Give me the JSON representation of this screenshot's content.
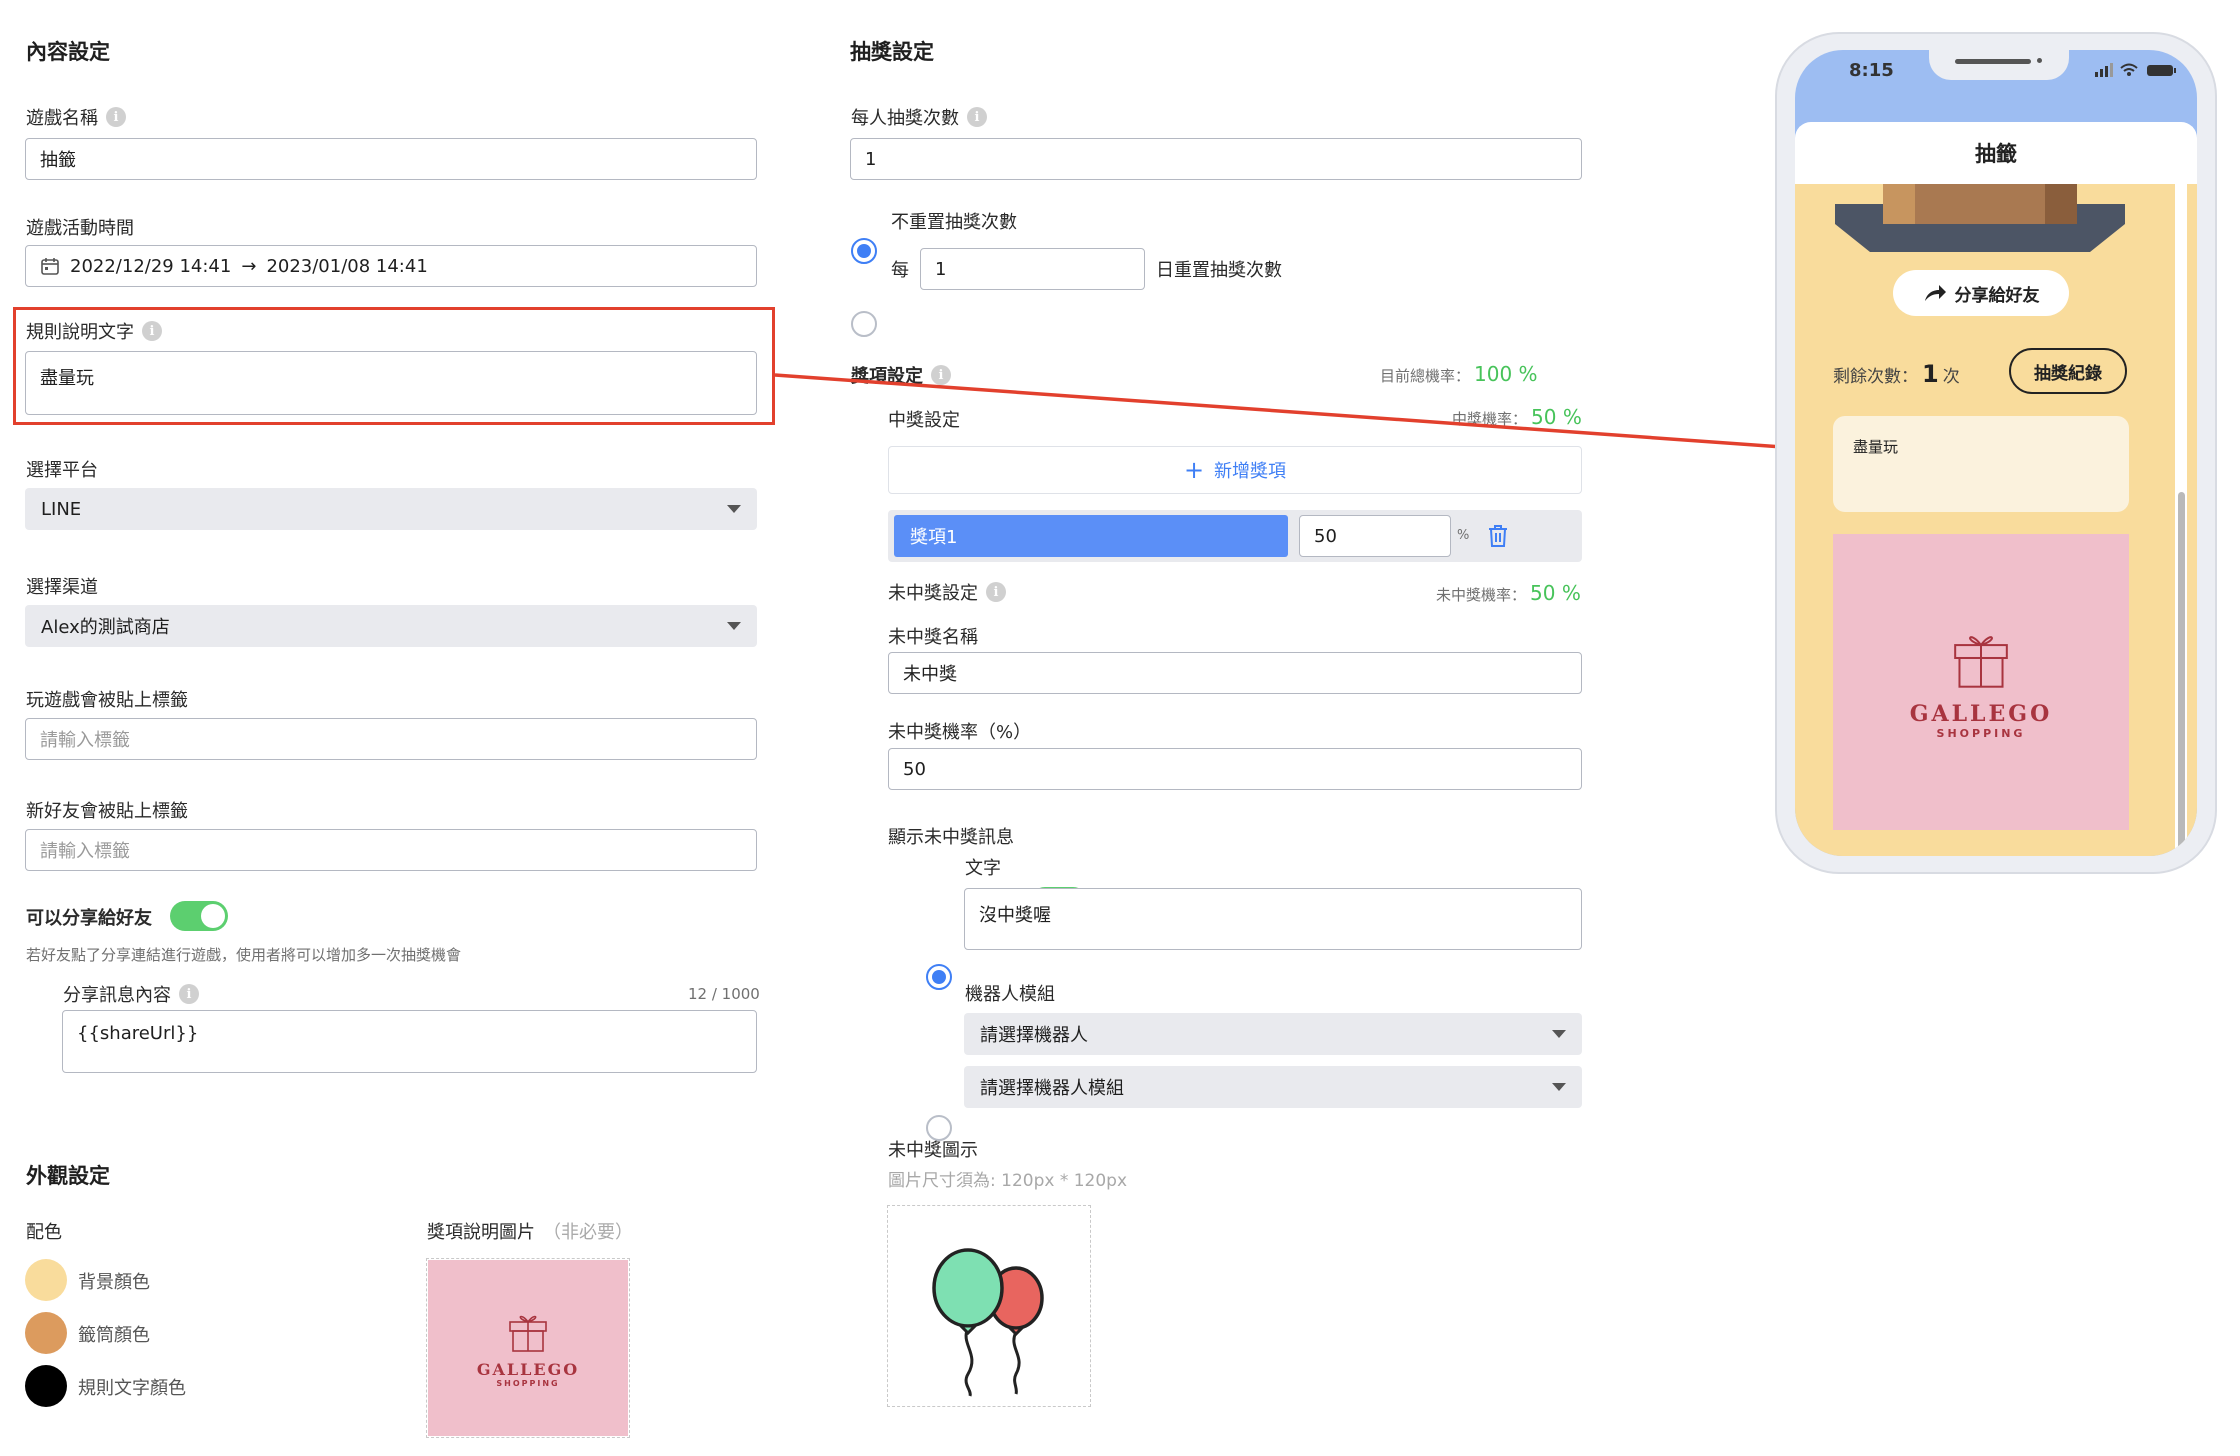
{
  "content": {
    "title": "內容設定",
    "game_name_label": "遊戲名稱",
    "game_name_value": "抽籤",
    "period_label": "遊戲活動時間",
    "period_start": "2022/12/29 14:41",
    "period_arrow": "→",
    "period_end": "2023/01/08 14:41",
    "rules_label": "規則說明文字",
    "rules_value": "盡量玩",
    "platform_label": "選擇平台",
    "platform_value": "LINE",
    "channel_label": "選擇渠道",
    "channel_value": "Alex的測試商店",
    "play_tag_label": "玩遊戲會被貼上標籤",
    "play_tag_placeholder": "請輸入標籤",
    "friend_tag_label": "新好友會被貼上標籤",
    "friend_tag_placeholder": "請輸入標籤",
    "share_label": "可以分享給好友",
    "share_hint": "若好友點了分享連結進行遊戲，使用者將可以增加多一次抽獎機會",
    "share_msg_label": "分享訊息內容",
    "share_msg_count": "12 / 1000",
    "share_msg_value": "{{shareUrl}}"
  },
  "appearance": {
    "title": "外觀設定",
    "colors_label": "配色",
    "colors": [
      {
        "label": "背景顏色",
        "hex": "#f9dc9c"
      },
      {
        "label": "籤筒顏色",
        "hex": "#dc9b5e"
      },
      {
        "label": "規則文字顏色",
        "hex": "#000000"
      }
    ],
    "prize_image_label": "獎項說明圖片",
    "prize_image_optional": "（非必要）"
  },
  "draw": {
    "title": "抽獎設定",
    "per_person_label": "每人抽獎次數",
    "per_person_value": "1",
    "no_reset_label": "不重置抽獎次數",
    "every_label": "每",
    "every_value": "1",
    "reset_suffix": "日重置抽獎次數"
  },
  "prizes": {
    "title": "獎項設定",
    "total_rate_label": "目前總機率：",
    "total_rate_value": "100 %",
    "win_label": "中獎設定",
    "win_rate_label": "中獎機率：",
    "win_rate_value": "50 %",
    "add_label": "新增獎項",
    "add_icon": "+",
    "item_name": "獎項1",
    "item_rate": "50",
    "item_unit": "%",
    "lose_label": "未中獎設定",
    "lose_rate_label": "未中獎機率：",
    "lose_rate_value": "50 %",
    "lose_name_label": "未中獎名稱",
    "lose_name_value": "未中獎",
    "lose_rate_input_label": "未中獎機率（%）",
    "lose_rate_input_value": "50",
    "show_lose_msg_label": "顯示未中獎訊息",
    "text_option": "文字",
    "text_value": "沒中獎喔",
    "bot_option": "機器人模組",
    "bot_select": "請選擇機器人",
    "bot_module_select": "請選擇機器人模組",
    "lose_image_label": "未中獎圖示",
    "lose_image_hint": "圖片尺寸須為: 120px * 120px"
  },
  "phone": {
    "time": "8:15",
    "title": "抽籤",
    "share_btn": "分享給好友",
    "remaining_label": "剩餘次數：",
    "remaining_value": "1",
    "remaining_unit": "次",
    "history_btn": "抽獎紀錄",
    "rules_text": "盡量玩"
  },
  "logo": {
    "brand": "GALLEGO",
    "sub": "SHOPPING"
  },
  "palette": {
    "accent": "#3f7ff5",
    "highlight": "#e2402d",
    "success": "#47c35a",
    "phone_bg": "#f9dc9c",
    "phone_top": "#9dbdf2",
    "logo_bg": "#f0bfcb",
    "logo_ink": "#a8343f"
  }
}
